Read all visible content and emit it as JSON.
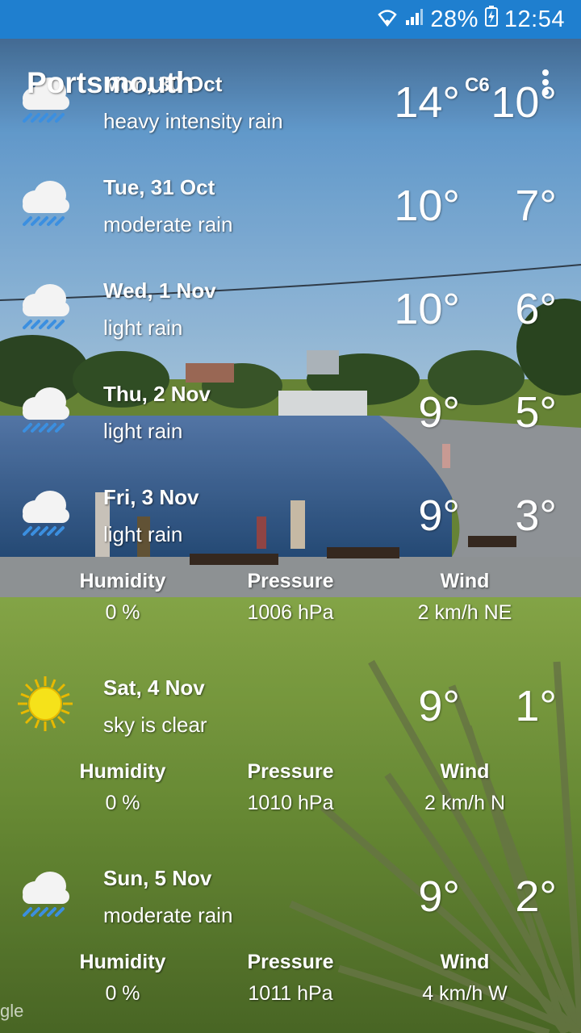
{
  "status_bar": {
    "battery": "28%",
    "time": "12:54"
  },
  "toolbar": {
    "city": "Portsmouth",
    "unit": "C6"
  },
  "forecast": [
    {
      "date": "Mon, 30 Oct",
      "desc": "heavy intensity rain",
      "max": "14°",
      "min": "10°",
      "icon": "rain-cloud-icon"
    },
    {
      "date": "Tue, 31 Oct",
      "desc": "moderate rain",
      "max": "10°",
      "min": "7°",
      "icon": "rain-cloud-icon"
    },
    {
      "date": "Wed, 1 Nov",
      "desc": "light rain",
      "max": "10°",
      "min": "6°",
      "icon": "rain-cloud-icon"
    },
    {
      "date": "Thu, 2 Nov",
      "desc": "light rain",
      "max": "9°",
      "min": "5°",
      "icon": "rain-cloud-icon"
    },
    {
      "date": "Fri, 3 Nov",
      "desc": "light rain",
      "max": "9°",
      "min": "3°",
      "icon": "rain-cloud-icon",
      "details": {
        "humidity_label": "Humidity",
        "humidity": "0 %",
        "pressure_label": "Pressure",
        "pressure": "1006 hPa",
        "wind_label": "Wind",
        "wind": "2 km/h NE"
      }
    },
    {
      "date": "Sat, 4 Nov",
      "desc": "sky is clear",
      "max": "9°",
      "min": "1°",
      "icon": "sun-icon",
      "details": {
        "humidity_label": "Humidity",
        "humidity": "0 %",
        "pressure_label": "Pressure",
        "pressure": "1010 hPa",
        "wind_label": "Wind",
        "wind": "2 km/h N"
      }
    },
    {
      "date": "Sun, 5 Nov",
      "desc": "moderate rain",
      "max": "9°",
      "min": "2°",
      "icon": "rain-cloud-icon",
      "details": {
        "humidity_label": "Humidity",
        "humidity": "0 %",
        "pressure_label": "Pressure",
        "pressure": "1011 hPa",
        "wind_label": "Wind",
        "wind": "4 km/h W"
      }
    }
  ],
  "watermark": "gle",
  "colors": {
    "status_bar": "#1f7fcf",
    "sky": "#5d9fd8",
    "water": "#2f5f9a",
    "grass": "#6f8f3a"
  }
}
